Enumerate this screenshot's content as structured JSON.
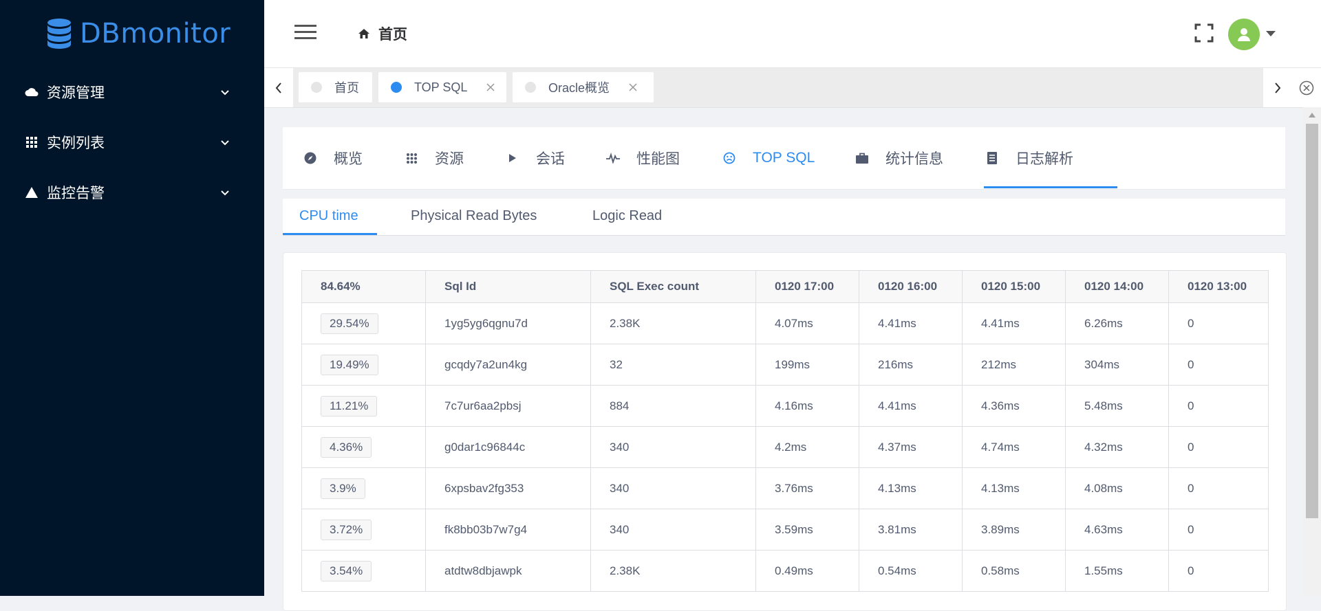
{
  "app": {
    "name": "DBmonitor"
  },
  "sidebar": {
    "items": [
      {
        "label": "资源管理",
        "icon": "cloud-icon"
      },
      {
        "label": "实例列表",
        "icon": "grid-icon"
      },
      {
        "label": "监控告警",
        "icon": "warning-icon"
      }
    ]
  },
  "header": {
    "breadcrumb": "首页"
  },
  "tabs": [
    {
      "label": "首页",
      "active": false
    },
    {
      "label": "TOP SQL",
      "active": true
    },
    {
      "label": "Oracle概览",
      "active": false
    }
  ],
  "main_tabs": [
    {
      "label": "概览",
      "icon": "compass-icon"
    },
    {
      "label": "资源",
      "icon": "grid-icon"
    },
    {
      "label": "会话",
      "icon": "play-icon"
    },
    {
      "label": "性能图",
      "icon": "pulse-icon"
    },
    {
      "label": "TOP SQL",
      "icon": "frown-icon",
      "active": true
    },
    {
      "label": "统计信息",
      "icon": "briefcase-icon"
    },
    {
      "label": "日志解析",
      "icon": "document-icon"
    }
  ],
  "sub_tabs": [
    {
      "label": "CPU time",
      "active": true
    },
    {
      "label": "Physical Read Bytes"
    },
    {
      "label": "Logic Read"
    }
  ],
  "table": {
    "headers": [
      "84.64%",
      "Sql Id",
      "SQL Exec count",
      "0120 17:00",
      "0120 16:00",
      "0120 15:00",
      "0120 14:00",
      "0120 13:00"
    ],
    "rows": [
      [
        "29.54%",
        "1yg5yg6qgnu7d",
        "2.38K",
        "4.07ms",
        "4.41ms",
        "4.41ms",
        "6.26ms",
        "0"
      ],
      [
        "19.49%",
        "gcqdy7a2un4kg",
        "32",
        "199ms",
        "216ms",
        "212ms",
        "304ms",
        "0"
      ],
      [
        "11.21%",
        "7c7ur6aa2pbsj",
        "884",
        "4.16ms",
        "4.41ms",
        "4.36ms",
        "5.48ms",
        "0"
      ],
      [
        "4.36%",
        "g0dar1c96844c",
        "340",
        "4.2ms",
        "4.37ms",
        "4.74ms",
        "4.32ms",
        "0"
      ],
      [
        "3.9%",
        "6xpsbav2fg353",
        "340",
        "3.76ms",
        "4.13ms",
        "4.13ms",
        "4.08ms",
        "0"
      ],
      [
        "3.72%",
        "fk8bb03b7w7g4",
        "340",
        "3.59ms",
        "3.81ms",
        "3.89ms",
        "4.63ms",
        "0"
      ],
      [
        "3.54%",
        "atdtw8dbjawpk",
        "2.38K",
        "0.49ms",
        "0.54ms",
        "0.58ms",
        "1.55ms",
        "0"
      ]
    ]
  },
  "colors": {
    "sidebar_bg": "#001529",
    "accent": "#2d8cf0",
    "logo": "#3b8ee8",
    "avatar": "#87c955"
  }
}
